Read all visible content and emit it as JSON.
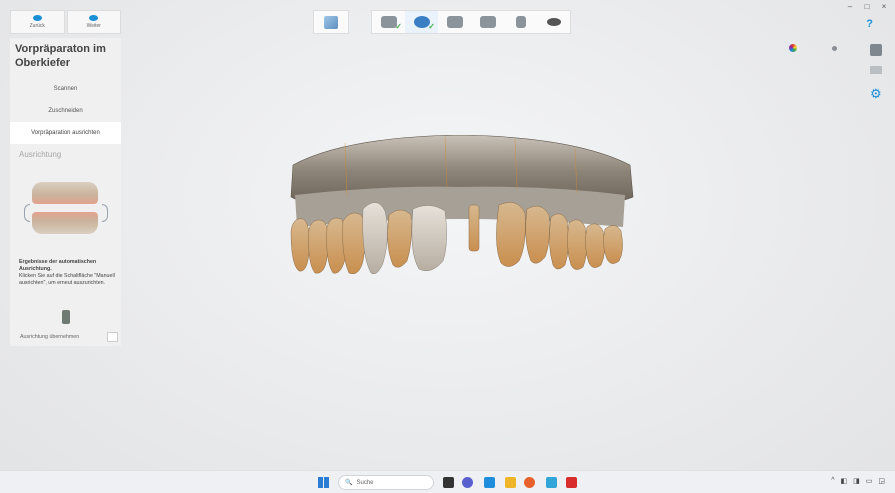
{
  "window": {
    "minimize": "–",
    "maximize": "□",
    "close": "×",
    "extra": "⋮"
  },
  "nav": {
    "back_label": "Zurück",
    "forward_label": "Weiter"
  },
  "panel": {
    "title": "Vorpräparaton im Oberkiefer",
    "steps": [
      {
        "label": "Scannen"
      },
      {
        "label": "Zuschneiden"
      },
      {
        "label": "Vorpräparation ausrichten"
      }
    ],
    "section_label": "Ausrichtung",
    "info_title": "Ergebnisse der automatischen Ausrichtung.",
    "info_text": "Klicken Sie auf die Schaltfläche \"Manuell ausrichten\", um erneut auszurichten.",
    "confirm_label": "Ausrichtung übernehmen"
  },
  "toolbar": {
    "icons": [
      "upper-jaw-scan-icon",
      "prep-scan-icon",
      "lower-jaw-scan-icon",
      "bite-scan-icon",
      "tooth-icon",
      "eye-icon"
    ],
    "selected_index": 1,
    "checked": [
      0,
      1
    ]
  },
  "right_tools": {
    "help_label": "?"
  },
  "taskbar": {
    "search_placeholder": "Suche",
    "tray_text": "^"
  },
  "colors": {
    "accent": "#1a8fd6",
    "check": "#45b04f",
    "panel_bg": "#f0f0f0"
  }
}
